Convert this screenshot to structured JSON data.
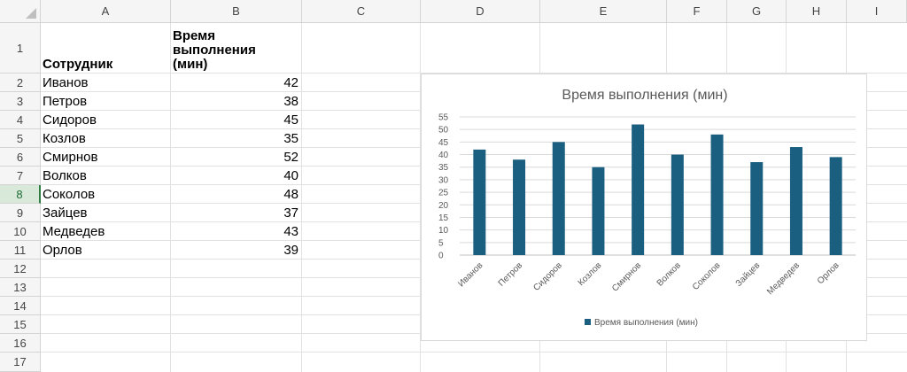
{
  "columns": [
    "A",
    "B",
    "C",
    "D",
    "E",
    "F",
    "G",
    "H",
    "I"
  ],
  "rows": [
    "1",
    "2",
    "3",
    "4",
    "5",
    "6",
    "7",
    "8",
    "9",
    "10",
    "11",
    "12",
    "13",
    "14",
    "15",
    "16",
    "17"
  ],
  "active_row": "8",
  "table": {
    "header": {
      "employee": "Сотрудник",
      "time_line1": "Время выполнения",
      "time_line2": "(мин)"
    },
    "records": [
      {
        "name": "Иванов",
        "value": "42"
      },
      {
        "name": "Петров",
        "value": "38"
      },
      {
        "name": "Сидоров",
        "value": "45"
      },
      {
        "name": "Козлов",
        "value": "35"
      },
      {
        "name": "Смирнов",
        "value": "52"
      },
      {
        "name": "Волков",
        "value": "40"
      },
      {
        "name": "Соколов",
        "value": "48"
      },
      {
        "name": "Зайцев",
        "value": "37"
      },
      {
        "name": "Медведев",
        "value": "43"
      },
      {
        "name": "Орлов",
        "value": "39"
      }
    ]
  },
  "chart_data": {
    "type": "bar",
    "title": "Время выполнения (мин)",
    "categories": [
      "Иванов",
      "Петров",
      "Сидоров",
      "Козлов",
      "Смирнов",
      "Волков",
      "Соколов",
      "Зайцев",
      "Медведев",
      "Орлов"
    ],
    "series": [
      {
        "name": "Время выполнения (мин)",
        "values": [
          42,
          38,
          45,
          35,
          52,
          40,
          48,
          37,
          43,
          39
        ],
        "color": "#1a5e80"
      }
    ],
    "ylim": [
      0,
      55
    ],
    "yticks": [
      "0",
      "5",
      "10",
      "15",
      "20",
      "25",
      "30",
      "35",
      "40",
      "45",
      "50",
      "55"
    ],
    "grid": true,
    "legend": "bottom"
  },
  "colors": {
    "bar": "#1a5e80",
    "grid": "#d9d9d9",
    "title": "#595959",
    "active_row": "#d8e8d9"
  }
}
